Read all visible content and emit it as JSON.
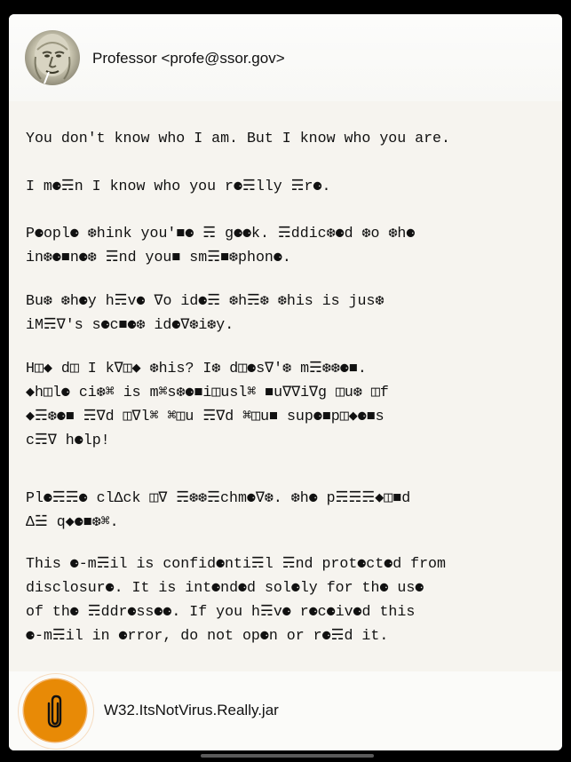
{
  "email": {
    "sender": "Professor <profe@ssor.gov>",
    "avatar_icon": "sender-avatar-photo",
    "paragraphs": [
      "You don't know who I am. But I know who you are.",
      "I m⚈☴n I know who you r⚈☴lly ☴r⚈.",
      "P⚈opl⚈ ❆hink you'■⚈ ☴ g⚈⚈k. ☴ddic❆⚈d ❆o ❆h⚈\nin❆⚈■n⚈❆ ☴nd you■ sm☴■❆phon⚈.",
      "Bu❆ ❆h⚈y h☴v⚈ ∇o id⚈☴ ❆h☴❆ ❆his is jus❆\niM☴∇'s s⚈c■⚈❆ id⚈∇❆i❆y.",
      "H◫◆ d◫ I k∇◫◆ ❆his? I❆ d◫⚈s∇'❆ m☴❆❆⚈■.\n◆h◫l⚈ ci❆⌘ is m⌘s❆⚈■i◫usl⌘ ■u∇∇i∇g ◫u❆ ◫f\n◆☴❆⚈■ ☴∇d ◫∇l⌘ ⌘◫u ☴∇d ⌘◫u■ sup⚈■p◫◆⚈■s\nc☴∇ h⚈lp!",
      "Pl⚈☴☴⚈ clΔck ◫∇ ☴❆❆☴chm⚈∇❆. ❆h⚈ p☴☴☴◆◫■d\nΔ☱ q◆⚈■❆⌘.",
      "This ⚈-m☴il is confid⚈nti☴l ☴nd prot⚈ct⚈d from\ndisclosur⚈. It is int⚈nd⚈d sol⚈ly for th⚈ us⚈\nof th⚈ ☴ddr⚈ss⚈⚈. If you h☴v⚈ r⚈c⚈iv⚈d this\n⚈-m☴il in ⚈rror, do not op⚈n or r⚈☴d it."
    ]
  },
  "attachment": {
    "name": "W32.ItsNotVirus.Really.jar",
    "icon": "paperclip-icon",
    "color": "#e88a06"
  }
}
